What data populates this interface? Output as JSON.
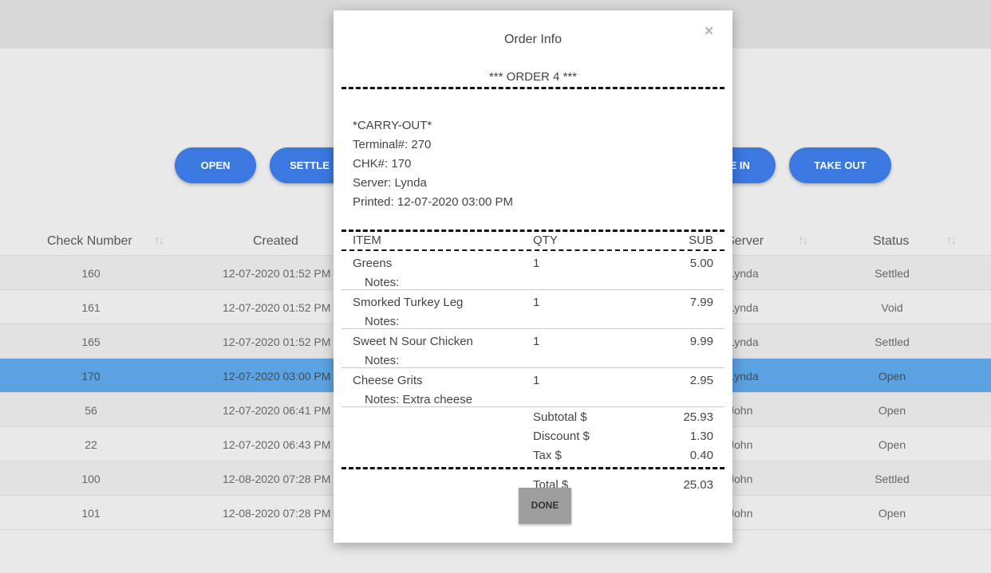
{
  "filters": {
    "open": "OPEN",
    "settle": "SETTLE",
    "dine_in": "DINE IN",
    "take_out": "TAKE OUT"
  },
  "table": {
    "headers": {
      "check_number": "Check Number",
      "created": "Created",
      "server": "Server",
      "status": "Status"
    },
    "rows": [
      {
        "num": "160",
        "created": "12-07-2020 01:52 PM",
        "server": "Lynda",
        "status": "Settled"
      },
      {
        "num": "161",
        "created": "12-07-2020 01:52 PM",
        "server": "Lynda",
        "status": "Void"
      },
      {
        "num": "165",
        "created": "12-07-2020 01:52 PM",
        "server": "Lynda",
        "status": "Settled"
      },
      {
        "num": "170",
        "created": "12-07-2020 03:00 PM",
        "server": "Lynda",
        "status": "Open"
      },
      {
        "num": "56",
        "created": "12-07-2020 06:41 PM",
        "server": "John",
        "status": "Open"
      },
      {
        "num": "22",
        "created": "12-07-2020 06:43 PM",
        "server": "John",
        "status": "Open"
      },
      {
        "num": "100",
        "created": "12-08-2020 07:28 PM",
        "server": "John",
        "status": "Settled"
      },
      {
        "num": "101",
        "created": "12-08-2020 07:28 PM",
        "server": "John",
        "status": "Open"
      }
    ],
    "selected_check": "170"
  },
  "modal": {
    "title": "Order Info",
    "close": "×",
    "order_header": "*** ORDER 4 ***",
    "info": {
      "type": "*CARRY-OUT*",
      "terminal": "Terminal#: 270",
      "check": "CHK#: 170",
      "server": "Server: Lynda",
      "printed": "Printed: 12-07-2020 03:00 PM"
    },
    "columns": {
      "item": "ITEM",
      "qty": "QTY",
      "sub": "SUB"
    },
    "items": [
      {
        "name": "Greens",
        "qty": "1",
        "sub": "5.00",
        "notes": "Notes:"
      },
      {
        "name": "Smorked Turkey Leg",
        "qty": "1",
        "sub": "7.99",
        "notes": "Notes:"
      },
      {
        "name": "Sweet N Sour Chicken",
        "qty": "1",
        "sub": "9.99",
        "notes": "Notes:"
      },
      {
        "name": "Cheese Grits",
        "qty": "1",
        "sub": "2.95",
        "notes": "Notes: Extra cheese"
      }
    ],
    "totals": {
      "subtotal_label": "Subtotal $",
      "subtotal": "25.93",
      "discount_label": "Discount $",
      "discount": "1.30",
      "tax_label": "Tax $",
      "tax": "0.40",
      "total_label": "Total $",
      "total": "25.03"
    },
    "done": "DONE"
  },
  "colors": {
    "accent": "#3b78e0",
    "selected_row": "#5aa2e2",
    "done_button": "#9e9e9e"
  }
}
